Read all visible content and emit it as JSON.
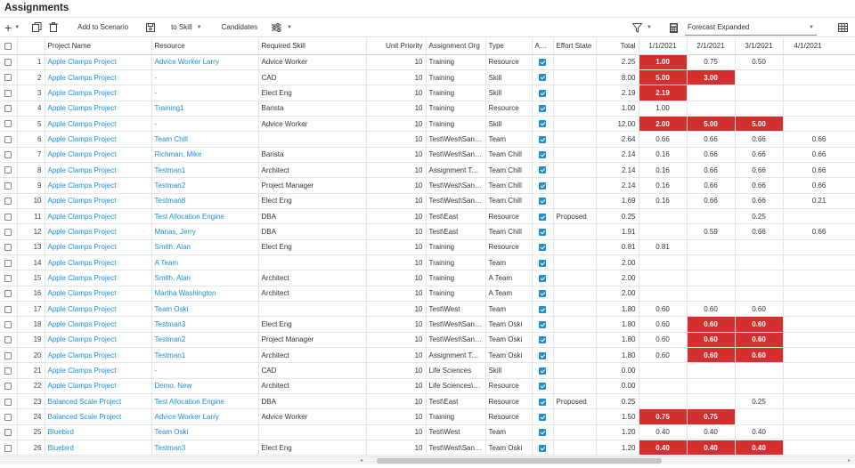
{
  "page": {
    "title": "Assignments"
  },
  "toolbar": {
    "add_label": "Add to Scenario",
    "to_skill_label": "to Skill",
    "candidates_label": "Candidates",
    "view_select": "Forecast Expanded"
  },
  "columns": {
    "project": "Project Name",
    "resource": "Resource",
    "skill": "Required Skill",
    "priority": "Unit Priority",
    "org": "Assignment Org",
    "type": "Type",
    "active": "Act...",
    "effort": "Effort State",
    "total": "Total",
    "months": [
      "1/1/2021",
      "2/1/2021",
      "3/1/2021",
      "4/1/2021"
    ]
  },
  "rows": [
    {
      "n": "1",
      "project": "Apple Clamps Project",
      "resource": "Advice Worker Larry",
      "skill": "Advice Worker",
      "priority": "10",
      "org": "Training",
      "type": "Resource",
      "effort": "",
      "total": "2.25",
      "m": [
        "1.00",
        "0.75",
        "0.50",
        ""
      ],
      "hot": [
        1,
        0,
        0,
        0
      ]
    },
    {
      "n": "2",
      "project": "Apple Clamps Project",
      "resource": "-",
      "skill": "CAD",
      "priority": "10",
      "org": "Training",
      "type": "Skill",
      "effort": "",
      "total": "8.00",
      "m": [
        "5.00",
        "3.00",
        "",
        ""
      ],
      "hot": [
        1,
        1,
        0,
        0
      ]
    },
    {
      "n": "3",
      "project": "Apple Clamps Project",
      "resource": "-",
      "skill": "Elect Eng",
      "priority": "10",
      "org": "Training",
      "type": "Skill",
      "effort": "",
      "total": "2.19",
      "m": [
        "2.19",
        "",
        "",
        ""
      ],
      "hot": [
        1,
        0,
        0,
        0
      ]
    },
    {
      "n": "4",
      "project": "Apple Clamps Project",
      "resource": "Training1",
      "skill": "Barista",
      "priority": "10",
      "org": "Training",
      "type": "Resource",
      "effort": "",
      "total": "1.00",
      "m": [
        "1.00",
        "",
        "",
        ""
      ],
      "hot": [
        0,
        0,
        0,
        0
      ]
    },
    {
      "n": "5",
      "project": "Apple Clamps Project",
      "resource": "-",
      "skill": "Advice Worker",
      "priority": "10",
      "org": "Training",
      "type": "Skill",
      "effort": "",
      "total": "12.00",
      "m": [
        "2.00",
        "5.00",
        "5.00",
        ""
      ],
      "hot": [
        1,
        1,
        1,
        0
      ]
    },
    {
      "n": "6",
      "project": "Apple Clamps Project",
      "resource": "Team Chill",
      "skill": "",
      "priority": "10",
      "org": "Test\\West\\San Fran...",
      "type": "Team",
      "effort": "",
      "total": "2.64",
      "m": [
        "0.66",
        "0.66",
        "0.66",
        "0.66"
      ],
      "hot": [
        0,
        0,
        0,
        0
      ]
    },
    {
      "n": "7",
      "project": "Apple Clamps Project",
      "resource": "Richman, Mike",
      "skill": "Barista",
      "priority": "10",
      "org": "Test\\West\\San Fran...",
      "type": "Team Chill",
      "effort": "",
      "total": "2.14",
      "m": [
        "0.16",
        "0.66",
        "0.66",
        "0.66"
      ],
      "hot": [
        0,
        0,
        0,
        0
      ]
    },
    {
      "n": "8",
      "project": "Apple Clamps Project",
      "resource": "Testman1",
      "skill": "Architect",
      "priority": "10",
      "org": "Assignment Testing...",
      "type": "Team Chill",
      "effort": "",
      "total": "2.14",
      "m": [
        "0.16",
        "0.66",
        "0.66",
        "0.66"
      ],
      "hot": [
        0,
        0,
        0,
        0
      ]
    },
    {
      "n": "9",
      "project": "Apple Clamps Project",
      "resource": "Testman2",
      "skill": "Project Manager",
      "priority": "10",
      "org": "Test\\West\\San Fran...",
      "type": "Team Chill",
      "effort": "",
      "total": "2.14",
      "m": [
        "0.16",
        "0.66",
        "0.66",
        "0.66"
      ],
      "hot": [
        0,
        0,
        0,
        0
      ]
    },
    {
      "n": "10",
      "project": "Apple Clamps Project",
      "resource": "Testman8",
      "skill": "Elect Eng",
      "priority": "10",
      "org": "Test\\West\\San Fran...",
      "type": "Team Chill",
      "effort": "",
      "total": "1.69",
      "m": [
        "0.16",
        "0.66",
        "0.66",
        "0.21"
      ],
      "hot": [
        0,
        0,
        0,
        0
      ]
    },
    {
      "n": "11",
      "project": "Apple Clamps Project",
      "resource": "Test Allocation Engine",
      "skill": "DBA",
      "priority": "10",
      "org": "Test\\East",
      "type": "Resource",
      "effort": "Proposed",
      "total": "0.25",
      "m": [
        "",
        "",
        "0.25",
        ""
      ],
      "hot": [
        0,
        0,
        0,
        0
      ]
    },
    {
      "n": "12",
      "project": "Apple Clamps Project",
      "resource": "Manas, Jerry",
      "skill": "DBA",
      "priority": "10",
      "org": "Test\\East",
      "type": "Team Chill",
      "effort": "",
      "total": "1.91",
      "m": [
        "",
        "0.59",
        "0.66",
        "0.66"
      ],
      "hot": [
        0,
        0,
        0,
        0
      ]
    },
    {
      "n": "13",
      "project": "Apple Clamps Project",
      "resource": "Smith, Alan",
      "skill": "Elect Eng",
      "priority": "10",
      "org": "Training",
      "type": "Resource",
      "effort": "",
      "total": "0.81",
      "m": [
        "0.81",
        "",
        "",
        ""
      ],
      "hot": [
        0,
        0,
        0,
        0
      ]
    },
    {
      "n": "14",
      "project": "Apple Clamps Project",
      "resource": "A Team",
      "skill": "",
      "priority": "10",
      "org": "Training",
      "type": "Team",
      "effort": "",
      "total": "2.00",
      "m": [
        "",
        "",
        "",
        ""
      ],
      "hot": [
        0,
        0,
        0,
        0
      ]
    },
    {
      "n": "15",
      "project": "Apple Clamps Project",
      "resource": "Smith, Alan",
      "skill": "Architect",
      "priority": "10",
      "org": "Training",
      "type": "A Team",
      "effort": "",
      "total": "2.00",
      "m": [
        "",
        "",
        "",
        ""
      ],
      "hot": [
        0,
        0,
        0,
        0
      ]
    },
    {
      "n": "16",
      "project": "Apple Clamps Project",
      "resource": "Martha Washington",
      "skill": "Architect",
      "priority": "10",
      "org": "Training",
      "type": "A Team",
      "effort": "",
      "total": "2.00",
      "m": [
        "",
        "",
        "",
        ""
      ],
      "hot": [
        0,
        0,
        0,
        0
      ]
    },
    {
      "n": "17",
      "project": "Apple Clamps Project",
      "resource": "Team Oski",
      "skill": "",
      "priority": "10",
      "org": "Test\\West",
      "type": "Team",
      "effort": "",
      "total": "1.80",
      "m": [
        "0.60",
        "0.60",
        "0.60",
        ""
      ],
      "hot": [
        0,
        0,
        0,
        0
      ]
    },
    {
      "n": "18",
      "project": "Apple Clamps Project",
      "resource": "Testman3",
      "skill": "Elect Eng",
      "priority": "10",
      "org": "Test\\West\\San Fran...",
      "type": "Team Oski",
      "effort": "",
      "total": "1.80",
      "m": [
        "0.60",
        "0.60",
        "0.60",
        ""
      ],
      "hot": [
        0,
        1,
        1,
        0
      ]
    },
    {
      "n": "19",
      "project": "Apple Clamps Project",
      "resource": "Testman2",
      "skill": "Project Manager",
      "priority": "10",
      "org": "Test\\West\\San Fran...",
      "type": "Team Oski",
      "effort": "",
      "total": "1.80",
      "m": [
        "0.60",
        "0.60",
        "0.60",
        ""
      ],
      "hot": [
        0,
        1,
        1,
        0
      ]
    },
    {
      "n": "20",
      "project": "Apple Clamps Project",
      "resource": "Testman1",
      "skill": "Architect",
      "priority": "10",
      "org": "Assignment Testing...",
      "type": "Team Oski",
      "effort": "",
      "total": "1.80",
      "m": [
        "0.60",
        "0.60",
        "0.60",
        ""
      ],
      "hot": [
        0,
        1,
        1,
        0
      ]
    },
    {
      "n": "21",
      "project": "Apple Clamps Project",
      "resource": "-",
      "skill": "CAD",
      "priority": "10",
      "org": "Life Sciences",
      "type": "Skill",
      "effort": "",
      "total": "0.00",
      "m": [
        "",
        "",
        "",
        ""
      ],
      "hot": [
        0,
        0,
        0,
        0
      ]
    },
    {
      "n": "22",
      "project": "Apple Clamps Project",
      "resource": "Demo, New",
      "skill": "Architect",
      "priority": "10",
      "org": "Life Sciences\\R&D",
      "type": "Resource",
      "effort": "",
      "total": "0.00",
      "m": [
        "",
        "",
        "",
        ""
      ],
      "hot": [
        0,
        0,
        0,
        0
      ]
    },
    {
      "n": "23",
      "project": "Balanced Scale Project",
      "resource": "Test Allocation Engine",
      "skill": "DBA",
      "priority": "10",
      "org": "Test\\East",
      "type": "Resource",
      "effort": "Proposed",
      "total": "0.25",
      "m": [
        "",
        "",
        "0.25",
        ""
      ],
      "hot": [
        0,
        0,
        0,
        0
      ]
    },
    {
      "n": "24",
      "project": "Balanced Scale Project",
      "resource": "Advice Worker Larry",
      "skill": "Advice Worker",
      "priority": "10",
      "org": "Training",
      "type": "Resource",
      "effort": "",
      "total": "1.50",
      "m": [
        "0.75",
        "0.75",
        "",
        ""
      ],
      "hot": [
        1,
        1,
        0,
        0
      ]
    },
    {
      "n": "25",
      "project": "Bluebird",
      "resource": "Team Oski",
      "skill": "",
      "priority": "10",
      "org": "Test\\West",
      "type": "Team",
      "effort": "",
      "total": "1.20",
      "m": [
        "0.40",
        "0.40",
        "0.40",
        ""
      ],
      "hot": [
        0,
        0,
        0,
        0
      ]
    },
    {
      "n": "26",
      "project": "Bluebird",
      "resource": "Testman3",
      "skill": "Elect Eng",
      "priority": "10",
      "org": "Test\\West\\San Fran...",
      "type": "Team Oski",
      "effort": "",
      "total": "1.20",
      "m": [
        "0.40",
        "0.40",
        "0.40",
        ""
      ],
      "hot": [
        1,
        1,
        1,
        0
      ]
    }
  ]
}
